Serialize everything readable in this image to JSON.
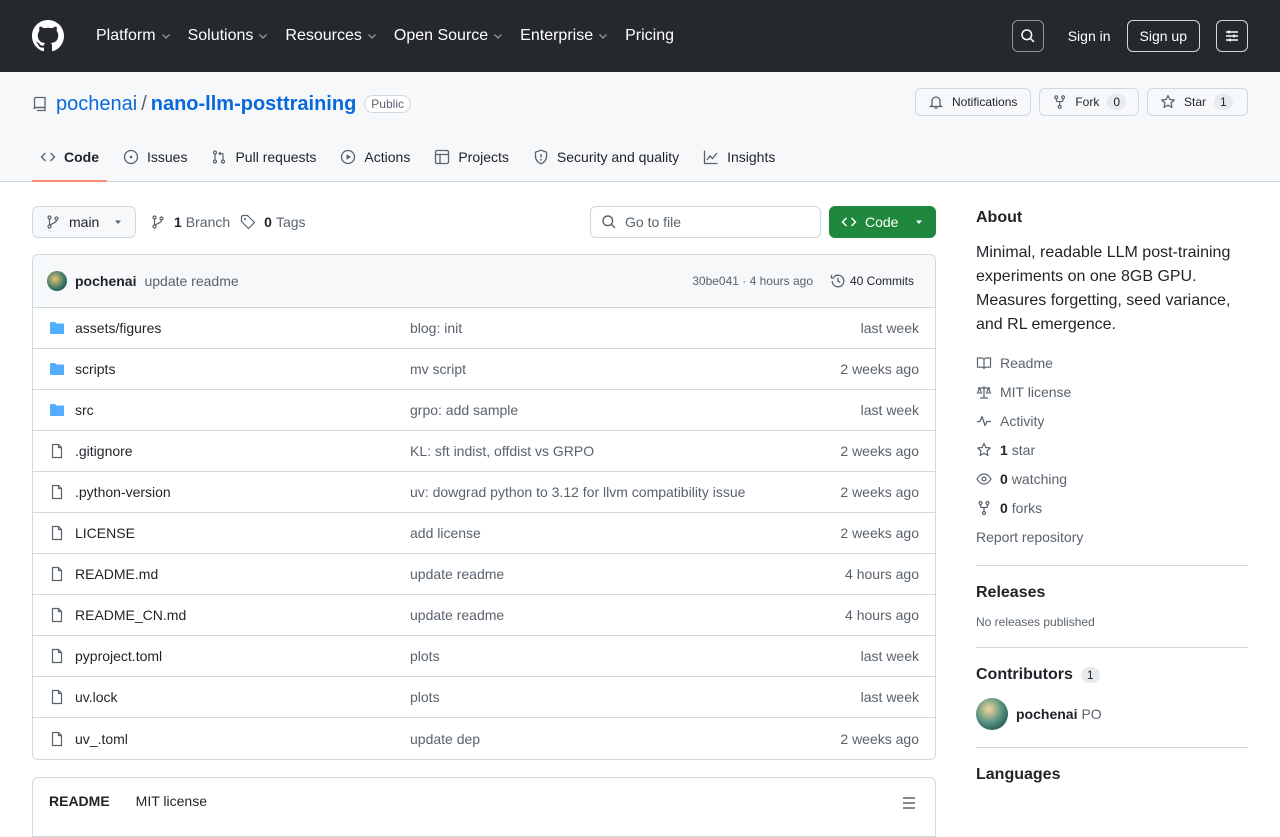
{
  "header": {
    "nav": [
      "Platform",
      "Solutions",
      "Resources",
      "Open Source",
      "Enterprise",
      "Pricing"
    ],
    "nav_has_chevron": [
      true,
      true,
      true,
      true,
      true,
      false
    ],
    "sign_in": "Sign in",
    "sign_up": "Sign up"
  },
  "repo": {
    "owner": "pochenai",
    "separator": "/",
    "name": "nano-llm-posttraining",
    "visibility": "Public",
    "notifications": "Notifications",
    "fork_label": "Fork",
    "fork_count": "0",
    "star_label": "Star",
    "star_count": "1"
  },
  "tabs": [
    {
      "label": "Code",
      "icon": "code-icon",
      "active": true
    },
    {
      "label": "Issues",
      "icon": "issue-icon",
      "active": false
    },
    {
      "label": "Pull requests",
      "icon": "pull-request-icon",
      "active": false
    },
    {
      "label": "Actions",
      "icon": "play-icon",
      "active": false
    },
    {
      "label": "Projects",
      "icon": "table-icon",
      "active": false
    },
    {
      "label": "Security and quality",
      "icon": "shield-icon",
      "active": false
    },
    {
      "label": "Insights",
      "icon": "graph-icon",
      "active": false
    }
  ],
  "filebar": {
    "branch": "main",
    "branch_count": "1",
    "branch_label": "Branch",
    "tag_count": "0",
    "tag_label": "Tags",
    "goto_placeholder": "Go to file",
    "code_button": "Code"
  },
  "latest_commit": {
    "author": "pochenai",
    "message": "update readme",
    "meta": "30be041 · 4 hours ago",
    "commits": "40 Commits"
  },
  "files": [
    {
      "name": "assets/figures",
      "type": "folder",
      "message": "blog: init",
      "date": "last week"
    },
    {
      "name": "scripts",
      "type": "folder",
      "message": "mv script",
      "date": "2 weeks ago"
    },
    {
      "name": "src",
      "type": "folder",
      "message": "grpo: add sample",
      "date": "last week"
    },
    {
      "name": ".gitignore",
      "type": "file",
      "message": "KL: sft indist, offdist vs GRPO",
      "date": "2 weeks ago"
    },
    {
      "name": ".python-version",
      "type": "file",
      "message": "uv: dowgrad python to 3.12 for llvm compatibility issue",
      "date": "2 weeks ago"
    },
    {
      "name": "LICENSE",
      "type": "file",
      "message": "add license",
      "date": "2 weeks ago"
    },
    {
      "name": "README.md",
      "type": "file",
      "message": "update readme",
      "date": "4 hours ago"
    },
    {
      "name": "README_CN.md",
      "type": "file",
      "message": "update readme",
      "date": "4 hours ago"
    },
    {
      "name": "pyproject.toml",
      "type": "file",
      "message": "plots",
      "date": "last week"
    },
    {
      "name": "uv.lock",
      "type": "file",
      "message": "plots",
      "date": "last week"
    },
    {
      "name": "uv_.toml",
      "type": "file",
      "message": "update dep",
      "date": "2 weeks ago"
    }
  ],
  "readme_tabs": {
    "readme": "README",
    "license": "MIT license"
  },
  "about": {
    "title": "About",
    "description": "Minimal, readable LLM post-training experiments on one 8GB GPU. Measures forgetting, seed variance, and RL emergence.",
    "readme": "Readme",
    "license": "MIT license",
    "activity": "Activity",
    "stars_count": "1",
    "stars_label": "star",
    "watching_count": "0",
    "watching_label": "watching",
    "forks_count": "0",
    "forks_label": "forks",
    "report": "Report repository"
  },
  "releases": {
    "title": "Releases",
    "empty": "No releases published"
  },
  "contributors": {
    "title": "Contributors",
    "count": "1",
    "name": "pochenai",
    "fullname": "PO"
  },
  "languages": {
    "title": "Languages"
  },
  "colors": {
    "header_bg": "#25292e",
    "link": "#0969da",
    "code_button": "#1f883d",
    "folder_icon": "#54aeff",
    "active_tab_underline": "#fd8c73"
  }
}
